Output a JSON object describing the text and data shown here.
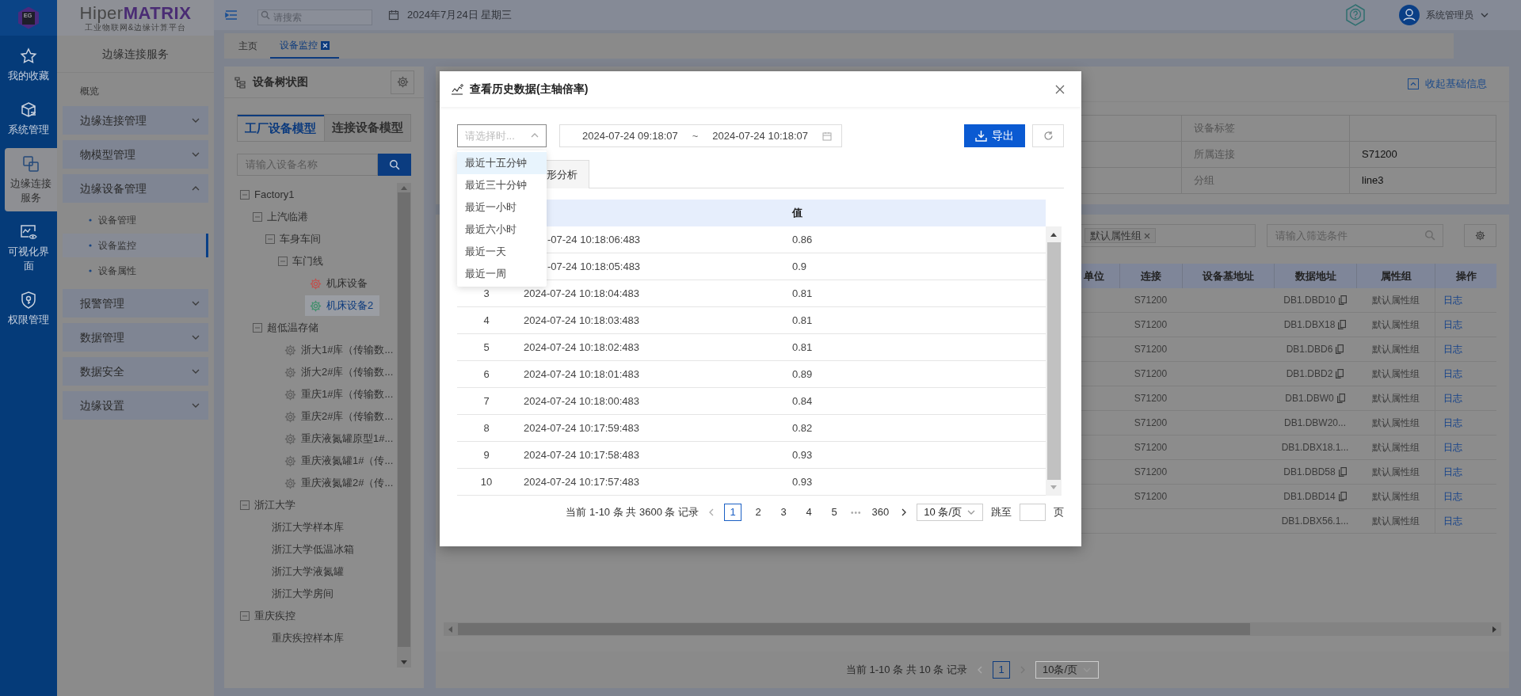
{
  "rail": {
    "logo_text": "EG",
    "items": [
      {
        "label": "我的收藏",
        "selected": false
      },
      {
        "label": "系统管理",
        "selected": false
      },
      {
        "label": "边缘连接服务",
        "selected": true
      },
      {
        "label": "可视化界面",
        "selected": false
      },
      {
        "label": "权限管理",
        "selected": false
      }
    ]
  },
  "brand": {
    "name_light": "Hiper",
    "name_bold": "MATRIX",
    "tagline": "工业物联网&边缘计算平台"
  },
  "sidebar": {
    "title": "边缘连接服务",
    "items": [
      {
        "kind": "link",
        "label": "概览"
      },
      {
        "kind": "group",
        "label": "边缘连接管理",
        "expanded": false
      },
      {
        "kind": "group",
        "label": "物模型管理",
        "expanded": false
      },
      {
        "kind": "group",
        "label": "边缘设备管理",
        "expanded": true,
        "children": [
          {
            "label": "设备管理",
            "selected": false
          },
          {
            "label": "设备监控",
            "selected": true
          },
          {
            "label": "设备属性",
            "selected": false
          }
        ]
      },
      {
        "kind": "group",
        "label": "报警管理",
        "expanded": false
      },
      {
        "kind": "group",
        "label": "数据管理",
        "expanded": false
      },
      {
        "kind": "group",
        "label": "数据安全",
        "expanded": false
      },
      {
        "kind": "group",
        "label": "边缘设置",
        "expanded": false
      }
    ]
  },
  "topbar": {
    "search_placeholder": "请搜索",
    "date": "2024年7月24日 星期三",
    "user": "系统管理员"
  },
  "page_tabs": [
    {
      "label": "主页",
      "selected": false,
      "closable": false
    },
    {
      "label": "设备监控",
      "selected": true,
      "closable": true
    }
  ],
  "tree_panel": {
    "title": "设备树状图",
    "tabs": [
      {
        "label": "工厂设备模型",
        "selected": true
      },
      {
        "label": "连接设备模型",
        "selected": false
      }
    ],
    "search_placeholder": "请输入设备名称",
    "nodes": [
      {
        "label": "Factory1",
        "selected": false,
        "expanded": true,
        "children": [
          {
            "label": "上汽临港",
            "selected": false,
            "expanded": true,
            "children": [
              {
                "label": "车身车间",
                "selected": false,
                "expanded": true,
                "children": [
                  {
                    "label": "车门线",
                    "selected": false,
                    "expanded": true,
                    "children": [
                      {
                        "label": "机床设备",
                        "selected": false,
                        "color": "#c0504d"
                      },
                      {
                        "label": "机床设备2",
                        "selected": true,
                        "color": "#3f8f6a"
                      }
                    ]
                  }
                ]
              }
            ]
          },
          {
            "label": "超低温存储",
            "selected": false,
            "expanded": true,
            "children": [
              {
                "label": "浙大1#库（传输数...",
                "selected": false,
                "color": "#5f5f5f"
              },
              {
                "label": "浙大2#库（传输数...",
                "selected": false,
                "color": "#5f5f5f"
              },
              {
                "label": "重庆1#库（传输数...",
                "selected": false,
                "color": "#5f5f5f"
              },
              {
                "label": "重庆2#库（传输数...",
                "selected": false,
                "color": "#5f5f5f"
              },
              {
                "label": "重庆液氮罐原型1#...",
                "selected": false,
                "color": "#5f5f5f"
              },
              {
                "label": "重庆液氮罐1#（传...",
                "selected": false,
                "color": "#5f5f5f"
              },
              {
                "label": "重庆液氮罐2#（传...",
                "selected": false,
                "color": "#5f5f5f"
              }
            ]
          }
        ]
      },
      {
        "label": "浙江大学",
        "selected": false,
        "expanded": true,
        "children": [
          {
            "label": "浙江大学样本库",
            "selected": false
          },
          {
            "label": "浙江大学低温冰箱",
            "selected": false
          },
          {
            "label": "浙江大学液氮罐",
            "selected": false
          },
          {
            "label": "浙江大学房间",
            "selected": false
          }
        ]
      },
      {
        "label": "重庆疾控",
        "selected": false,
        "expanded": true,
        "children": [
          {
            "label": "重庆疾控样本库",
            "selected": false
          }
        ]
      }
    ]
  },
  "info_card": {
    "toggle": "收起基础信息",
    "rows": [
      {
        "label": "设备标签"
      },
      {
        "label": "所属连接",
        "value": "S71200"
      },
      {
        "label": "分组",
        "value": "line3"
      }
    ]
  },
  "property_card": {
    "tag": "默认属性组",
    "filter_placeholder": "请输入筛选条件",
    "columns": [
      "单位",
      "连接",
      "设备基地址",
      "数据地址",
      "属性组",
      "操作"
    ],
    "rows": [
      {
        "connection": "S71200",
        "address": "DB1.DBD10",
        "copy": true,
        "group": "默认属性组",
        "action": "日志"
      },
      {
        "connection": "S71200",
        "address": "DB1.DBX18",
        "copy": true,
        "group": "默认属性组",
        "action": "日志"
      },
      {
        "connection": "S71200",
        "address": "DB1.DBD6",
        "copy": true,
        "group": "默认属性组",
        "action": "日志"
      },
      {
        "connection": "S71200",
        "address": "DB1.DBD2",
        "copy": true,
        "group": "默认属性组",
        "action": "日志"
      },
      {
        "connection": "S71200",
        "address": "DB1.DBW0",
        "copy": true,
        "group": "默认属性组",
        "action": "日志"
      },
      {
        "connection": "S71200",
        "address": "DB1.DBW20...",
        "copy": false,
        "group": "默认属性组",
        "action": "日志"
      },
      {
        "connection": "S71200",
        "address": "DB1.DBX18.1...",
        "copy": false,
        "group": "默认属性组",
        "action": "日志"
      },
      {
        "connection": "S71200",
        "address": "DB1.DBD58",
        "copy": true,
        "group": "默认属性组",
        "action": "日志"
      },
      {
        "connection": "S71200",
        "address": "DB1.DBD14",
        "copy": true,
        "group": "默认属性组",
        "action": "日志"
      },
      {
        "address": "DB1.DBX56.1...",
        "copy": false,
        "group": "默认属性组",
        "action": "日志"
      }
    ],
    "pagination": {
      "summary": "当前 1-10 条 共 10 条 记录",
      "pages": [
        {
          "kind": "page",
          "label": "1",
          "selected": true
        }
      ],
      "page_size": "10条/页"
    }
  },
  "modal": {
    "title": "查看历史数据(主轴倍率)",
    "range_select": {
      "placeholder": "请选择时...",
      "expanded": true
    },
    "range": {
      "start": "2024-07-24 09:18:07",
      "separator": "~",
      "end": "2024-07-24 10:18:07"
    },
    "export": "导出",
    "dropdown": [
      {
        "label": "最近十五分钟",
        "selected": true
      },
      {
        "label": "最近三十分钟",
        "selected": false
      },
      {
        "label": "最近一小时",
        "selected": false
      },
      {
        "label": "最近六小时",
        "selected": false
      },
      {
        "label": "最近一天",
        "selected": false
      },
      {
        "label": "最近一周",
        "selected": false
      }
    ],
    "tabs": [
      {
        "label": "形分析",
        "selected": false
      }
    ],
    "table": {
      "value_header": "值",
      "rows": [
        {
          "time": "-07-24 10:18:06:483",
          "value": "0.86"
        },
        {
          "time": "-07-24 10:18:05:483",
          "value": "0.9"
        },
        {
          "index": "3",
          "time": "2024-07-24 10:18:04:483",
          "value": "0.81"
        },
        {
          "index": "4",
          "time": "2024-07-24 10:18:03:483",
          "value": "0.81"
        },
        {
          "index": "5",
          "time": "2024-07-24 10:18:02:483",
          "value": "0.81"
        },
        {
          "index": "6",
          "time": "2024-07-24 10:18:01:483",
          "value": "0.89"
        },
        {
          "index": "7",
          "time": "2024-07-24 10:18:00:483",
          "value": "0.84"
        },
        {
          "index": "8",
          "time": "2024-07-24 10:17:59:483",
          "value": "0.82"
        },
        {
          "index": "9",
          "time": "2024-07-24 10:17:58:483",
          "value": "0.93"
        },
        {
          "index": "10",
          "time": "2024-07-24 10:17:57:483",
          "value": "0.93"
        }
      ]
    },
    "pagination": {
      "summary": "当前 1-10 条 共 3600 条 记录",
      "pages": [
        {
          "kind": "page",
          "label": "1",
          "selected": true
        },
        {
          "kind": "page",
          "label": "2",
          "selected": false
        },
        {
          "kind": "page",
          "label": "3",
          "selected": false
        },
        {
          "kind": "page",
          "label": "4",
          "selected": false
        },
        {
          "kind": "page",
          "label": "5",
          "selected": false
        },
        {
          "kind": "ellipsis",
          "label": "•••"
        },
        {
          "kind": "page",
          "label": "360",
          "selected": false
        }
      ],
      "page_size": "10 条/页",
      "jump_label": "跳至",
      "jump_suffix": "页"
    }
  }
}
